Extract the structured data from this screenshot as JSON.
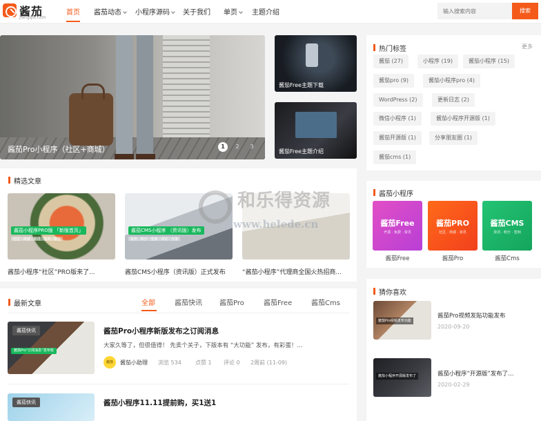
{
  "header": {
    "logo_text": "酱茄",
    "logo_sub": "jiangqie.com",
    "nav": [
      {
        "label": "首页",
        "active": true
      },
      {
        "label": "酱茄动态",
        "dropdown": true
      },
      {
        "label": "小程序源码",
        "dropdown": true
      },
      {
        "label": "关于我们"
      },
      {
        "label": "单页",
        "dropdown": true
      },
      {
        "label": "主题介绍"
      }
    ],
    "search": {
      "placeholder": "输入搜索内容",
      "button": "搜索"
    }
  },
  "hero": {
    "caption": "酱茄Pro小程序（社区+商城）",
    "pager": [
      "1",
      "2",
      "3"
    ]
  },
  "side_cards": [
    {
      "caption": "酱茄Free主题下载"
    },
    {
      "caption": "酱茄Free主题介绍"
    }
  ],
  "featured": {
    "title": "精选文章",
    "items": [
      {
        "tag": "酱茄小程序PRO版 「新版首页」",
        "sub": "社区 · 商城 · 资讯 · 发布 · 积分",
        "title": "酱茄小程序“社区”PRO版来了..."
      },
      {
        "tag": "酱茄CMS小程序 （资讯版）发布",
        "sub": "资讯 · 积分 · 签到 · 评论 · 分享",
        "title": "酱茄CMS小程序（资讯版）正式发布"
      },
      {
        "tag": "",
        "sub": "",
        "title": "“酱茄小程序”代理商全国火热招商..."
      }
    ]
  },
  "latest": {
    "title": "最新文章",
    "tabs": [
      {
        "label": "全部",
        "active": true
      },
      {
        "label": "酱茄快讯"
      },
      {
        "label": "酱茄Pro"
      },
      {
        "label": "酱茄Free"
      },
      {
        "label": "酱茄Cms"
      }
    ],
    "articles": [
      {
        "tag": "酱茄快讯",
        "img_caption": "酱茄Pro“订阅消息”发布啦",
        "title": "酱茄Pro小程序新版发布之订阅消息",
        "desc": "大家久等了，但很值得！ 先卖个关子，下版本有 “大功能” 发布，有彩蛋！...",
        "author": "酱茄小助理",
        "avatar_text": "酱茄",
        "views": "浏览 534",
        "likes": "点赞 1",
        "comments": "评论 0",
        "time": "2周前 (11-09)"
      },
      {
        "tag": "酱茄快讯",
        "title": "酱茄小程序11.11提前购，买1送1"
      }
    ]
  },
  "sidebar": {
    "hot_tags": {
      "title": "热门标签",
      "more": "更多",
      "tags": [
        "酱茄 (27)",
        "小程序 (19)",
        "酱茄小程序 (15)",
        "酱茄pro (9)",
        "酱茄小程序pro (4)",
        "WordPress (2)",
        "更新日志 (2)",
        "微信小程序 (1)",
        "酱茄小程序开源版 (1)",
        "酱茄开源版 (1)",
        "分享朋友圈 (1)",
        "酱茄cms (1)"
      ]
    },
    "miniapps": {
      "title": "酱茄小程序",
      "items": [
        {
          "card": "酱茄Free",
          "sub": "开源 · 免费 · 资讯",
          "name": "酱茄Free"
        },
        {
          "card": "酱茄PRO",
          "sub": "社区 · 商城 · 资讯",
          "name": "酱茄Pro"
        },
        {
          "card": "酱茄CMS",
          "sub": "资讯 · 积分 · 签到",
          "name": "酱茄Cms"
        }
      ]
    },
    "guess": {
      "title": "猜你喜欢",
      "items": [
        {
          "img_caption": "酱茄Pro视频发布功能",
          "title": "酱茄Pro视频发贴功能发布",
          "date": "2020-09-20"
        },
        {
          "img_caption": "酱茄小程序开源版发布了",
          "title": "酱茄小程序“开源版”发布了...",
          "date": "2020-02-29"
        }
      ]
    }
  },
  "watermark": {
    "text": "和乐得资源",
    "url": "www.helede.cn"
  },
  "colors": {
    "accent": "#f45a1a",
    "free": "#d548c9",
    "pro": "#f5501b",
    "cms": "#1cb565",
    "tag_green": "#19b85d"
  }
}
